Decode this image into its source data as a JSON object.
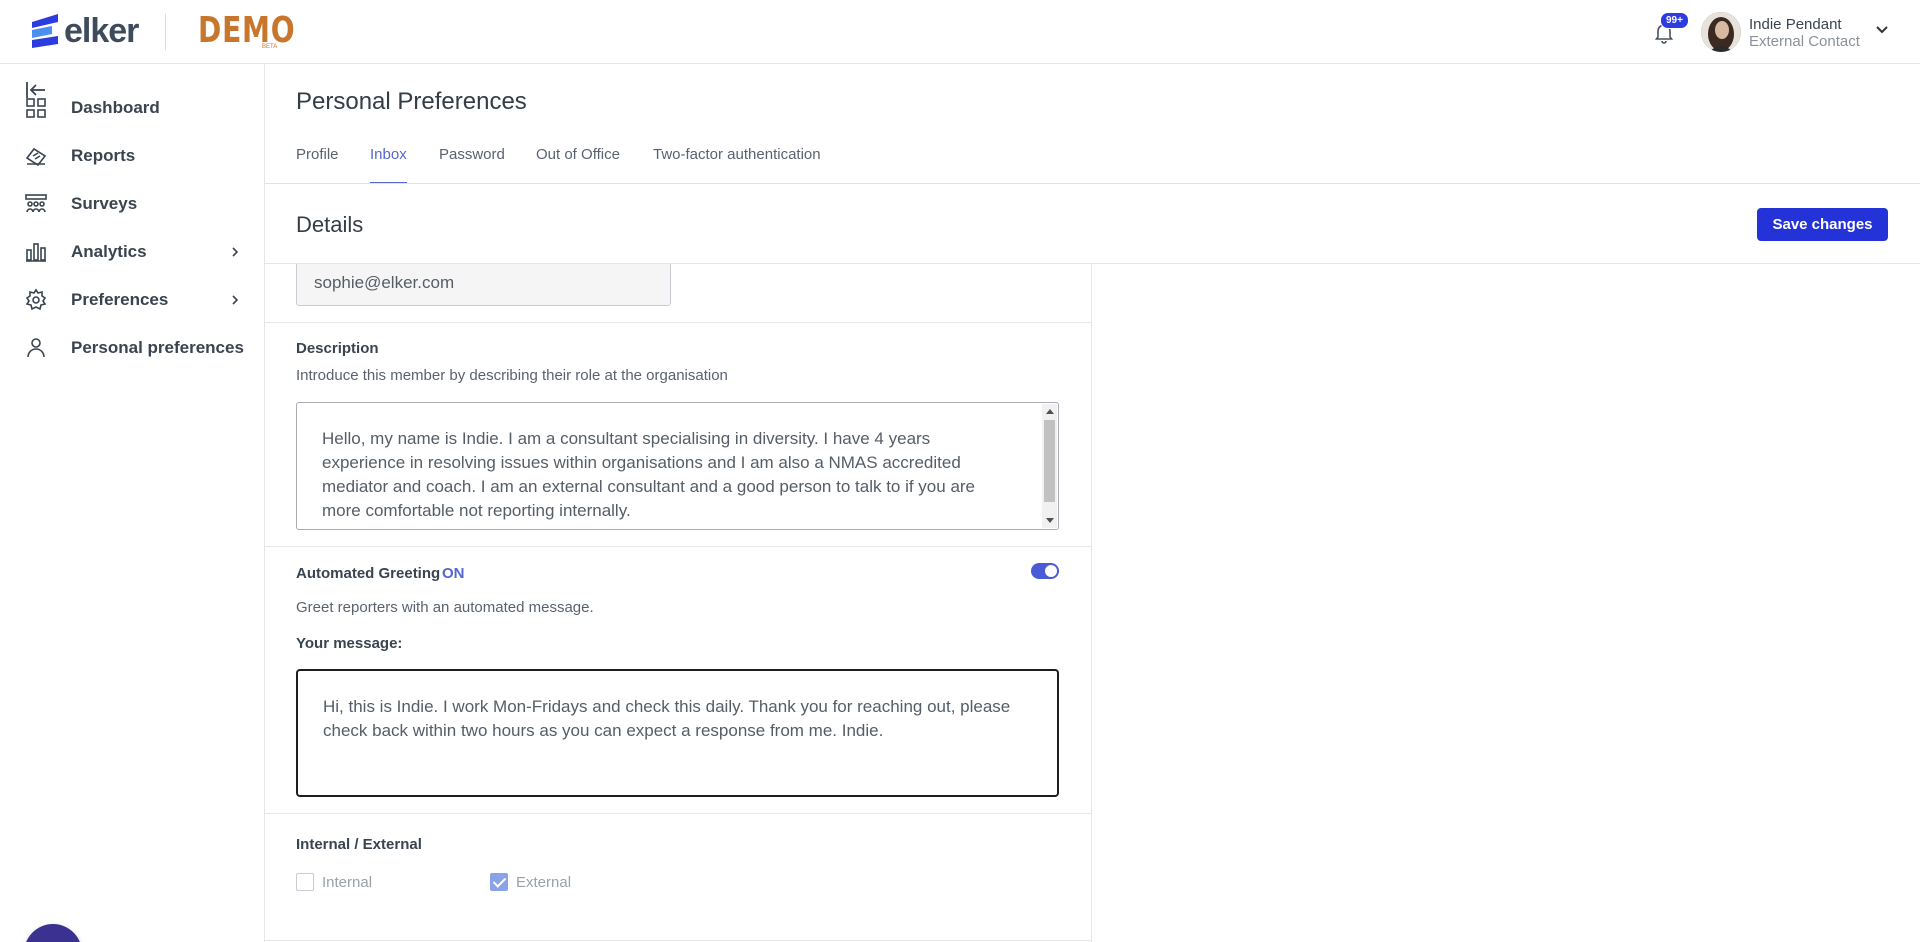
{
  "brand": {
    "logo_text": "elker",
    "demo_label": "DEMO",
    "demo_sub": "BETA"
  },
  "notifications": {
    "badge": "99+"
  },
  "user": {
    "name": "Indie Pendant",
    "role": "External Contact"
  },
  "sidebar": {
    "items": [
      {
        "label": "Dashboard",
        "icon": "dashboard-icon"
      },
      {
        "label": "Reports",
        "icon": "reports-icon"
      },
      {
        "label": "Surveys",
        "icon": "surveys-icon"
      },
      {
        "label": "Analytics",
        "icon": "analytics-icon",
        "has_submenu": true
      },
      {
        "label": "Preferences",
        "icon": "gear-icon",
        "has_submenu": true
      },
      {
        "label": "Personal preferences",
        "icon": "person-icon"
      }
    ]
  },
  "page": {
    "title": "Personal Preferences",
    "tabs": [
      {
        "label": "Profile"
      },
      {
        "label": "Inbox",
        "active": true
      },
      {
        "label": "Password"
      },
      {
        "label": "Out of Office"
      },
      {
        "label": "Two-factor authentication"
      }
    ]
  },
  "details": {
    "title": "Details",
    "save_label": "Save changes"
  },
  "form": {
    "email_value": "sophie@elker.com",
    "description": {
      "label": "Description",
      "help": "Introduce this member by describing their role at the organisation",
      "value": "Hello, my name is Indie. I am a consultant specialising in diversity. I have 4 years experience in resolving issues within organisations and I am also a NMAS accredited mediator and coach. I am an external consultant and a good person to talk to if you are more comfortable not reporting internally."
    },
    "greeting": {
      "label": "Automated Greeting",
      "status": "ON",
      "enabled": true,
      "help": "Greet reporters with an automated message.",
      "message_label": "Your message:",
      "message_value": "Hi, this is Indie. I work Mon-Fridays and check this daily. Thank you for reaching out, please check back within two hours as you can expect a response from me. Indie."
    },
    "internal_external": {
      "label": "Internal / External",
      "options": [
        {
          "label": "Internal",
          "checked": false
        },
        {
          "label": "External",
          "checked": true
        }
      ]
    }
  },
  "colors": {
    "accent": "#2433d8",
    "active_tab": "#5566cc",
    "demo": "#c8762c",
    "chat": "#3b3190"
  }
}
